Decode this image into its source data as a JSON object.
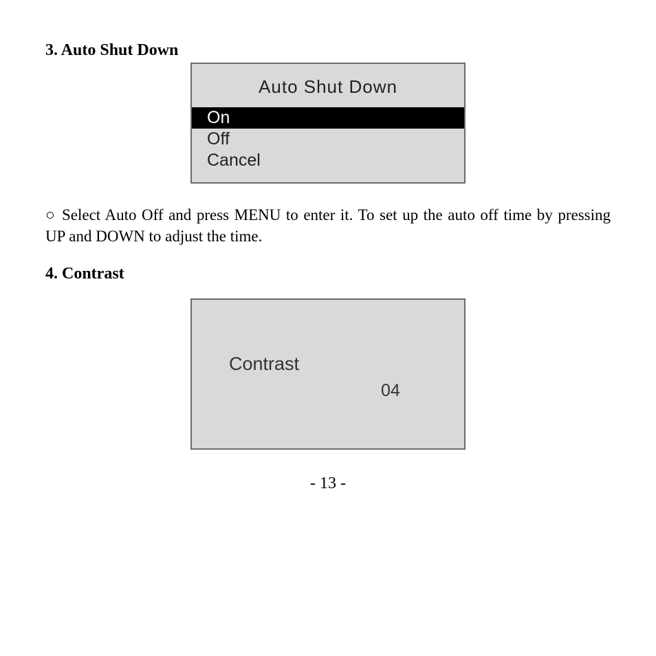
{
  "section3": {
    "heading": "3. Auto Shut Down",
    "menu": {
      "title": "Auto Shut Down",
      "items": [
        {
          "label": "On",
          "selected": true
        },
        {
          "label": "Off",
          "selected": false
        },
        {
          "label": "Cancel",
          "selected": false
        }
      ]
    },
    "instruction_bullet": "○",
    "instruction": "Select Auto Off and press MENU to enter it. To set up the auto off time by pressing UP and DOWN to adjust the time."
  },
  "section4": {
    "heading": "4. Contrast",
    "panel": {
      "label": "Contrast",
      "value": "04"
    }
  },
  "page_number": "- 13 -"
}
